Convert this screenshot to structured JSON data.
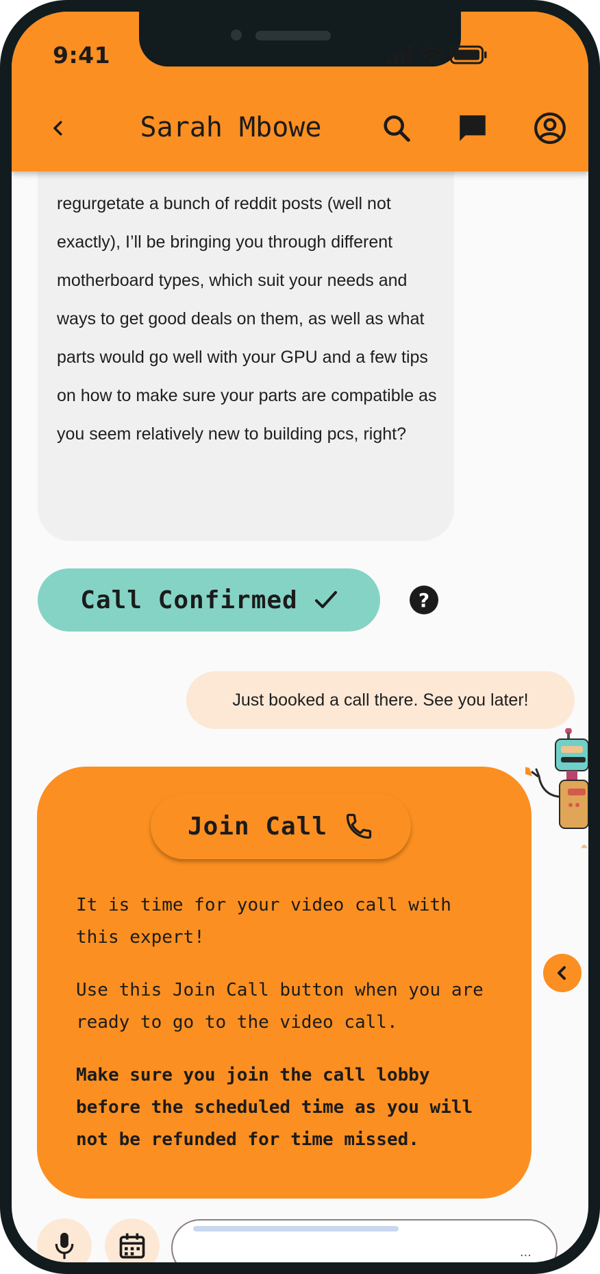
{
  "status_bar": {
    "time": "9:41",
    "icons": [
      "signal-icon",
      "wifi-icon",
      "battery-icon"
    ]
  },
  "header": {
    "title": "Sarah Mbowe",
    "back_icon": "chevron-left-icon",
    "search_icon": "search-icon",
    "chat_icon": "chat-bubble-icon",
    "profile_icon": "account-circle-icon"
  },
  "messages": {
    "incoming_text": "regurgetate a bunch of reddit posts (well not exactly), I’ll be bringing you through different motherboard types, which suit your needs and ways to get good deals on them, as well as what parts would go well with your GPU and a few tips on how to make sure your parts are compatible as you seem relatively new to building pcs, right?",
    "confirmed_label": "Call Confirmed",
    "outgoing_text": "Just booked a call there. See you later!"
  },
  "call_card": {
    "join_label": "Join Call",
    "paragraph1": "It is time for your video call with this expert!",
    "paragraph2": "Use this Join Call button when you are ready to go to the video call.",
    "paragraph3": "Make sure you join the call lobby before the scheduled time as you will not be refunded for time missed."
  },
  "composer": {
    "mic_icon": "microphone-icon",
    "calendar_icon": "calendar-icon",
    "more_indicator": "..."
  },
  "colors": {
    "accent_orange": "#fb8f21",
    "teal": "#85d3c5",
    "peach": "#fde8d5",
    "bubble_grey": "#f0f0f0",
    "frame": "#121c1e"
  }
}
